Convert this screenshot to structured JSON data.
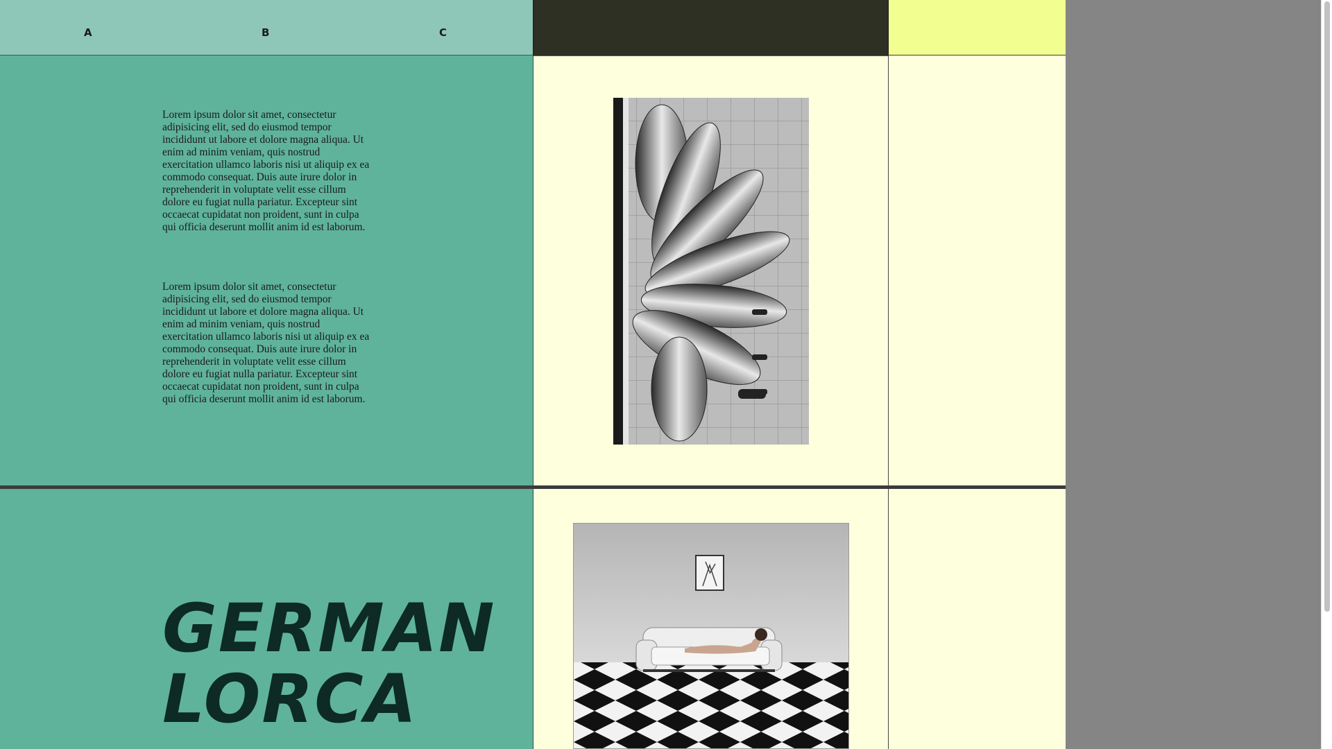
{
  "nav": {
    "items": [
      {
        "label": "A"
      },
      {
        "label": "B"
      },
      {
        "label": "C"
      }
    ]
  },
  "content": {
    "paragraphs": [
      "Lorem ipsum dolor sit amet, consectetur adipisicing elit, sed do eiusmod tempor incididunt ut labore et dolore magna aliqua. Ut enim ad minim veniam, quis nostrud exercitation ullamco laboris nisi ut aliquip ex ea commodo consequat. Duis aute irure dolor in reprehenderit in voluptate velit esse cillum dolore eu fugiat nulla pariatur. Excepteur sint occaecat cupidatat non proident, sunt in culpa qui officia deserunt mollit anim id est laborum.",
      "Lorem ipsum dolor sit amet, consectetur adipisicing elit, sed do eiusmod tempor incididunt ut labore et dolore magna aliqua. Ut enim ad minim veniam, quis nostrud exercitation ullamco laboris nisi ut aliquip ex ea commodo consequat. Duis aute irure dolor in reprehenderit in voluptate velit esse cillum dolore eu fugiat nulla pariatur. Excepteur sint occaecat cupidatat non proident, sunt in culpa qui officia deserunt mollit anim id est laborum."
    ],
    "headline_line1": "GERMAN",
    "headline_line2": "LORCA"
  },
  "colors": {
    "teal": "#5fb39b",
    "teal_light": "#8ec7b7",
    "dark": "#2e3024",
    "yellow": "#f3fe90",
    "cream": "#fdffdd",
    "backdrop": "#858585"
  },
  "images": [
    {
      "name": "plates-sink-photo"
    },
    {
      "name": "sofa-checkerboard-photo"
    }
  ]
}
